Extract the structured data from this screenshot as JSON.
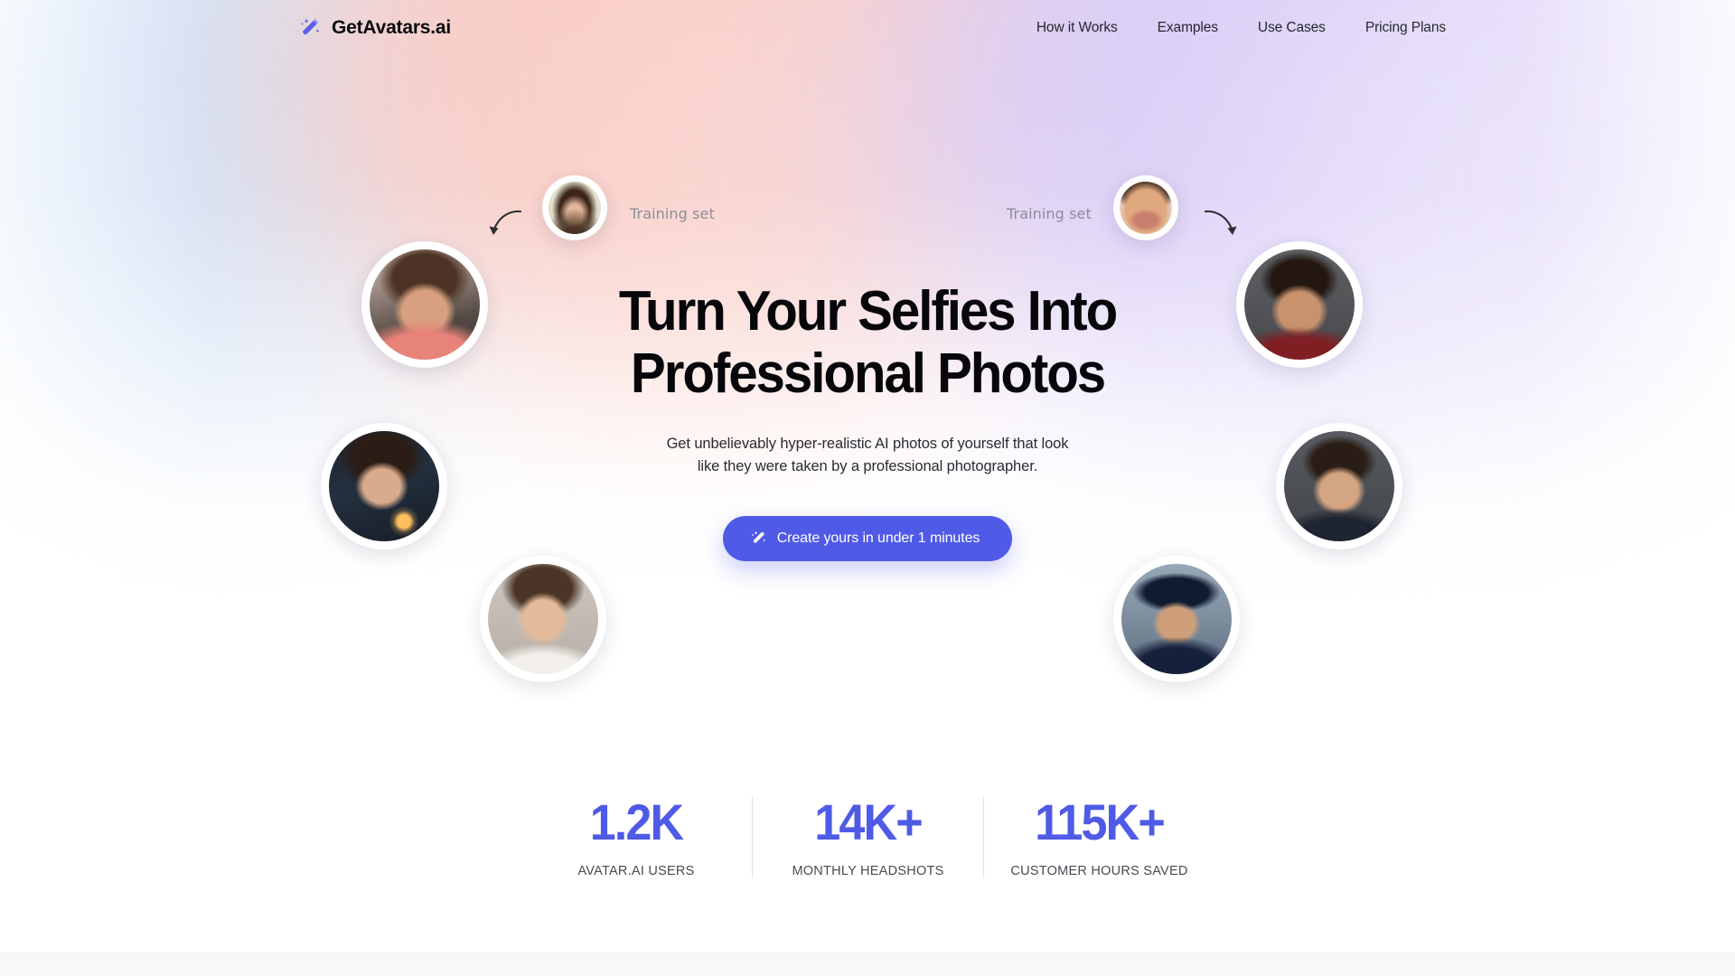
{
  "brand": {
    "name": "GetAvatars.ai",
    "icon": "magic-wand-icon",
    "color": "#4f5ae6"
  },
  "nav": {
    "items": [
      {
        "label": "How it Works"
      },
      {
        "label": "Examples"
      },
      {
        "label": "Use Cases"
      },
      {
        "label": "Pricing Plans"
      }
    ]
  },
  "hero": {
    "headline_line1": "Turn Your Selfies Into",
    "headline_line2": "Professional Photos",
    "subhead_line1": "Get unbelievably hyper-realistic AI photos of yourself that look",
    "subhead_line2": "like they were taken by a professional photographer.",
    "cta_label": "Create yours in under 1 minutes",
    "cta_icon": "magic-wand-icon",
    "cta_color": "#4f5ae6"
  },
  "annotations": {
    "training_set_left": "Training set",
    "training_set_right": "Training set",
    "arrow_left": "curved-arrow-left-icon",
    "arrow_right": "curved-arrow-right-icon"
  },
  "avatars": [
    {
      "name": "avatar-training-left",
      "description": "woman with long dark hair, neutral cream background"
    },
    {
      "name": "avatar-training-right",
      "description": "smiling bald man with beard"
    },
    {
      "name": "avatar-kimono-woman",
      "description": "woman in pink floral kimono with cherry blossoms"
    },
    {
      "name": "avatar-military-man",
      "description": "man in red ceremonial military uniform, grey backdrop"
    },
    {
      "name": "avatar-fantasy-woman",
      "description": "woman holding glowing lantern in dark forest"
    },
    {
      "name": "avatar-suited-man",
      "description": "man in dark suit and tie, grey studio backdrop"
    },
    {
      "name": "avatar-business-woman",
      "description": "woman in white blazer, soft neutral backdrop"
    },
    {
      "name": "avatar-naval-officer",
      "description": "naval officer in peaked cap aboard ship"
    }
  ],
  "stats": {
    "items": [
      {
        "value": "1.2K",
        "label": "AVATAR.AI USERS"
      },
      {
        "value": "14K+",
        "label": "MONTHLY HEADSHOTS"
      },
      {
        "value": "115K+",
        "label": "CUSTOMER HOURS SAVED"
      }
    ],
    "accent_color": "#4f5ae6"
  },
  "theme": {
    "background": "#ffffff",
    "gradient_blue": "#b9d2f2",
    "gradient_peach": "#f7b8ae",
    "gradient_violet": "#cdbdf4",
    "text_primary": "#07070b",
    "text_muted": "#8d8d96"
  }
}
